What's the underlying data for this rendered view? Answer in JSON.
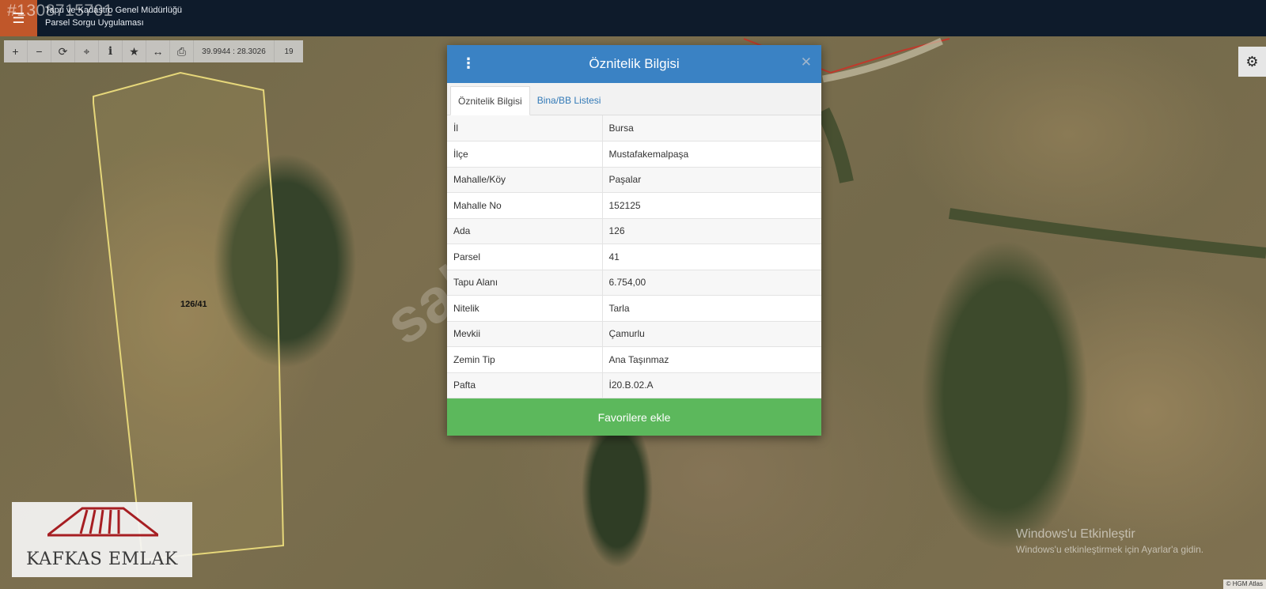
{
  "header": {
    "org_title": "Tapu ve Kadastro Genel Müdürlüğü",
    "app_subtitle": "Parsel Sorgu Uygulaması",
    "listing_overlay": "#1308715701"
  },
  "toolbar": {
    "tools": [
      {
        "name": "zoom-in-icon",
        "glyph": "+"
      },
      {
        "name": "zoom-out-icon",
        "glyph": "−"
      },
      {
        "name": "refresh-icon",
        "glyph": "⟳"
      },
      {
        "name": "locate-icon",
        "glyph": "⌖"
      },
      {
        "name": "info-icon",
        "glyph": "i"
      },
      {
        "name": "star-icon",
        "glyph": "★"
      },
      {
        "name": "measure-icon",
        "glyph": "↔"
      },
      {
        "name": "print-icon",
        "glyph": "⎙"
      }
    ],
    "coordinates": "39.9944 : 28.3026",
    "zoom_level": "19"
  },
  "modal": {
    "title": "Öznitelik Bilgisi",
    "tabs": [
      {
        "label": "Öznitelik Bilgisi",
        "active": true
      },
      {
        "label": "Bina/BB Listesi",
        "active": false
      }
    ],
    "rows": [
      {
        "key": "İl",
        "value": "Bursa"
      },
      {
        "key": "İlçe",
        "value": "Mustafakemalpaşa"
      },
      {
        "key": "Mahalle/Köy",
        "value": "Paşalar"
      },
      {
        "key": "Mahalle No",
        "value": "152125"
      },
      {
        "key": "Ada",
        "value": "126"
      },
      {
        "key": "Parsel",
        "value": "41"
      },
      {
        "key": "Tapu Alanı",
        "value": "6.754,00"
      },
      {
        "key": "Nitelik",
        "value": "Tarla"
      },
      {
        "key": "Mevkii",
        "value": "Çamurlu"
      },
      {
        "key": "Zemin Tip",
        "value": "Ana Taşınmaz"
      },
      {
        "key": "Pafta",
        "value": "İ20.B.02.A"
      }
    ],
    "favorite_button": "Favorilere ekle"
  },
  "map": {
    "parcel_label": "126/41",
    "attribution": "© HGM Atlas"
  },
  "overlays": {
    "watermark": "sahibinden.com",
    "logo_text": "KAFKAS EMLAK",
    "windows_activate_title": "Windows'u Etkinleştir",
    "windows_activate_desc": "Windows'u etkinleştirmek için Ayarlar'a gidin."
  },
  "colors": {
    "header_bg": "#0e1b2b",
    "menu_accent": "#c0572a",
    "modal_header": "#3a82c4",
    "favorite_green": "#5cb85c",
    "parcel_outline": "#e6d77a"
  }
}
